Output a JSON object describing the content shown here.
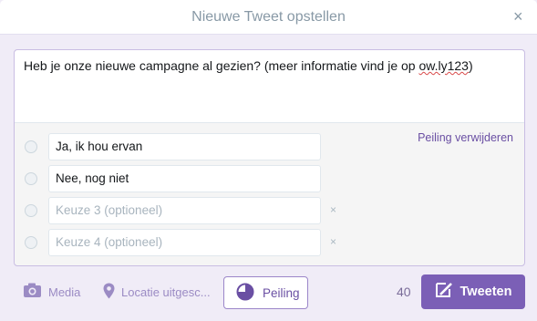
{
  "dialog": {
    "title": "Nieuwe Tweet opstellen",
    "close_glyph": "×"
  },
  "composer": {
    "text_before_link": "Heb je onze nieuwe campagne al gezien? (meer informatie vind je op ",
    "link_text": "ow.ly123",
    "text_after_link": ")"
  },
  "poll": {
    "remove_label": "Peiling verwijderen",
    "choices": [
      {
        "value": "Ja, ik hou ervan",
        "placeholder": ""
      },
      {
        "value": "Nee, nog niet",
        "placeholder": ""
      },
      {
        "value": "",
        "placeholder": "Keuze 3 (optioneel)"
      },
      {
        "value": "",
        "placeholder": "Keuze 4 (optioneel)"
      }
    ],
    "remove_choice_glyph": "×"
  },
  "toolbar": {
    "media_label": "Media",
    "media_icon": "camera-icon",
    "location_label": "Locatie uitgesc...",
    "location_icon": "location-pin-icon",
    "poll_label": "Peiling",
    "poll_icon": "poll-icon",
    "char_count": "40",
    "tweet_label": "Tweeten",
    "tweet_icon": "compose-icon"
  },
  "colors": {
    "accent": "#7b5fb6",
    "background": "#f0ecf7"
  }
}
